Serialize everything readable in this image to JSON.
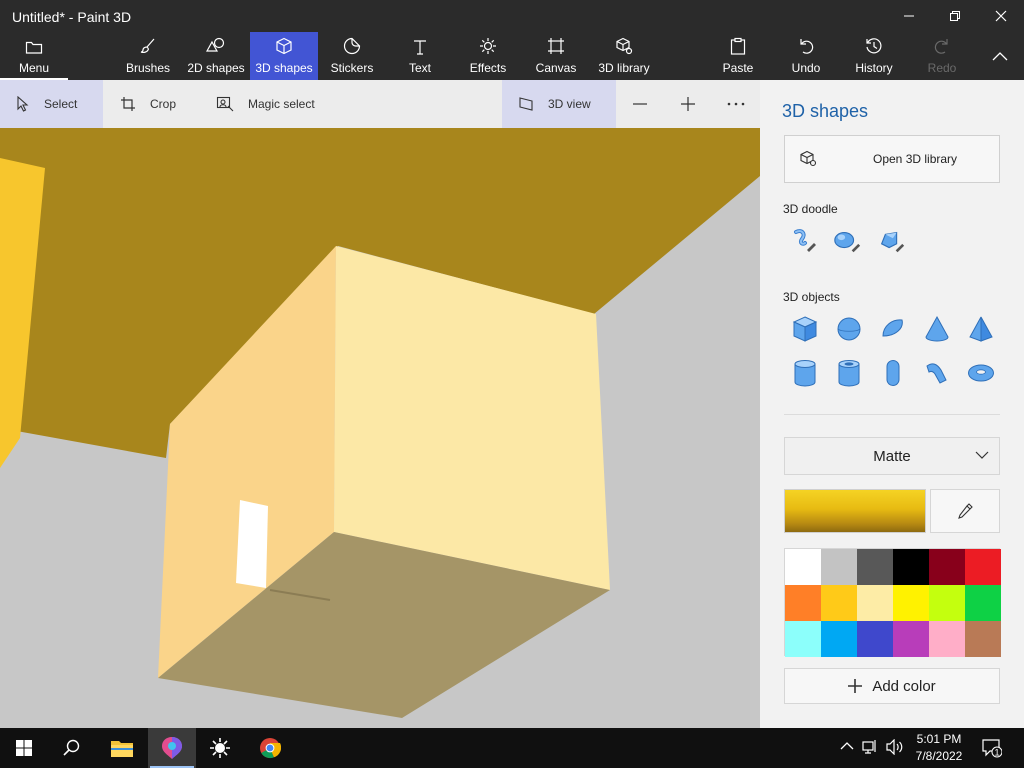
{
  "window": {
    "title": "Untitled* - Paint 3D"
  },
  "ribbon": {
    "menu": "Menu",
    "brushes": "Brushes",
    "shapes2d": "2D shapes",
    "shapes3d": "3D shapes",
    "stickers": "Stickers",
    "text": "Text",
    "effects": "Effects",
    "canvas": "Canvas",
    "library3d": "3D library",
    "paste": "Paste",
    "undo": "Undo",
    "history": "History",
    "redo": "Redo"
  },
  "subbar": {
    "select": "Select",
    "crop": "Crop",
    "magic_select": "Magic select",
    "view3d": "3D view"
  },
  "panel": {
    "title": "3D shapes",
    "open_library": "Open 3D library",
    "doodle_label": "3D doodle",
    "objects_label": "3D objects",
    "material": "Matte",
    "add_color": "Add color",
    "current_color": "#e8be16",
    "palette": [
      "#ffffff",
      "#c3c3c3",
      "#585858",
      "#000000",
      "#88001b",
      "#ec1c24",
      "#ff7f27",
      "#ffca18",
      "#fdeca6",
      "#fff200",
      "#c4ff0e",
      "#0ed145",
      "#8cfffb",
      "#00a8f3",
      "#3f48cc",
      "#b83dba",
      "#ffaec8",
      "#b97a56"
    ]
  },
  "taskbar": {
    "time": "5:01 PM",
    "date": "7/8/2022",
    "notification_count": "1"
  }
}
